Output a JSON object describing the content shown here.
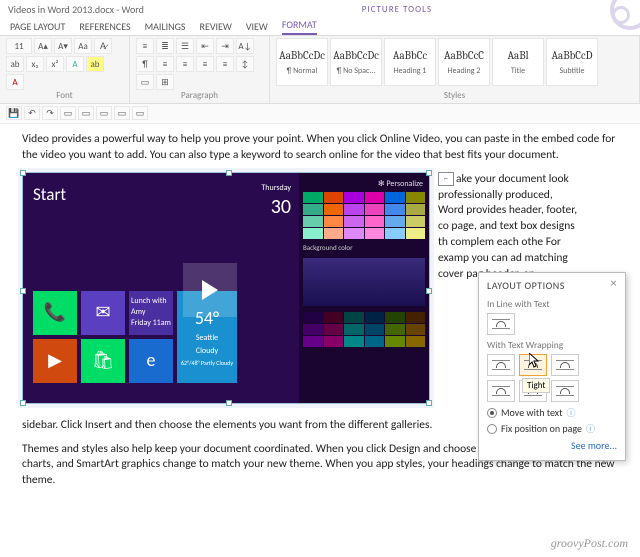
{
  "window": {
    "title": "Videos in Word 2013.docx - Word",
    "contextual_tool": "PICTURE TOOLS"
  },
  "tabs": [
    "PAGE LAYOUT",
    "REFERENCES",
    "MAILINGS",
    "REVIEW",
    "VIEW",
    "FORMAT"
  ],
  "active_tab_index": 5,
  "ribbon": {
    "font_size": "11",
    "groups": {
      "font": "Font",
      "paragraph": "Paragraph",
      "styles": "Styles"
    },
    "styles": [
      {
        "preview": "AaBbCcDc",
        "name": "¶ Normal"
      },
      {
        "preview": "AaBbCcDc",
        "name": "¶ No Spac..."
      },
      {
        "preview": "AaBbCc",
        "name": "Heading 1"
      },
      {
        "preview": "AaBbCcC",
        "name": "Heading 2"
      },
      {
        "preview": "AaBl",
        "name": "Title"
      },
      {
        "preview": "AaBbCcD",
        "name": "Subtitle"
      }
    ]
  },
  "document": {
    "p1": "Video provides a powerful way to help you prove your point. When you click Online Video, you can paste in the embed code for the video you want to add. You can also type a keyword to search online for the video that best fits your document.",
    "p_wrap": "ake your document look professionally produced, Word provides header, footer, co\npage, and text box designs th complem each othe For examp you can ad matching cover pag header, an",
    "p2": "sidebar. Click Insert and then choose the elements you want from the different galleries.",
    "p3": "Themes and styles also help keep your document coordinated. When you click Design and choose a n Theme, the pictures, charts, and SmartArt graphics change to match your new theme. When you app styles, your headings change to match the new theme."
  },
  "video": {
    "start": "Start",
    "personalize": "✻ Personalize",
    "temp": "54°",
    "city": "Seattle",
    "cond": "Cloudy",
    "hi_lo": "62°/48° Partly Cloudy",
    "day": "Thursday",
    "date": "30",
    "bg_label": "Background color"
  },
  "layout_popup": {
    "title": "LAYOUT OPTIONS",
    "sec1": "In Line with Text",
    "sec2": "With Text Wrapping",
    "tooltip": "Tight",
    "radio1": "Move with text",
    "radio2": "Fix position on page",
    "seemore": "See more..."
  },
  "watermark": "groovyPost.com"
}
